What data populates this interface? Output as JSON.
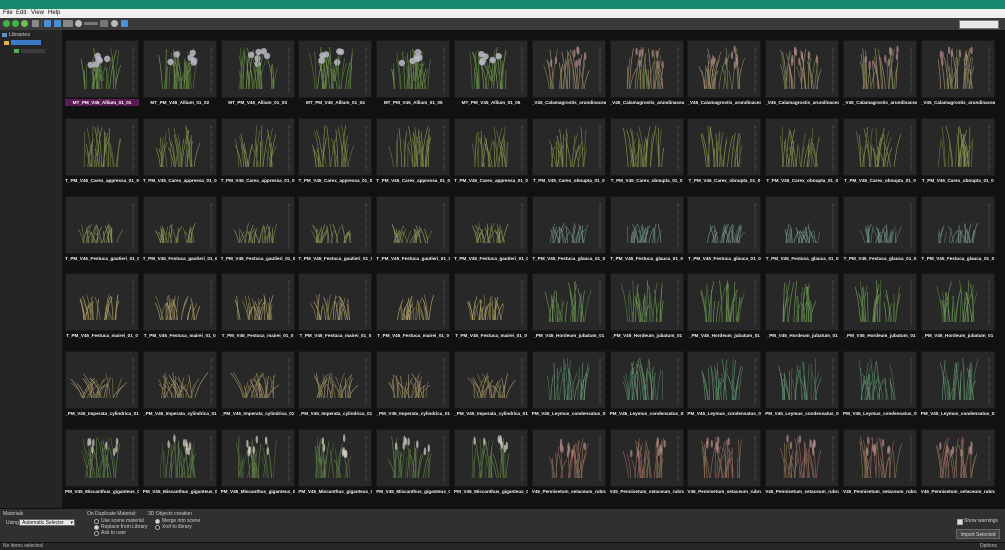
{
  "menu": {
    "file": "File",
    "edit": "Edit",
    "view": "View",
    "help": "Help"
  },
  "tree": {
    "root": "Libraries"
  },
  "materials": {
    "section": "Materials",
    "using_label": "Using:",
    "using_value": "Automatic Selector",
    "on_duplicate_title": "On Duplicate Material:",
    "options": [
      "Use scene material",
      "Replace from Library",
      "Ask to user"
    ],
    "selected_option": 1
  },
  "objects": {
    "title": "3D Objects creation",
    "options": [
      "Merge into scene",
      "Xref to library"
    ],
    "selected_option": 0
  },
  "show_warnings": "Show warnings",
  "import_button": "Import Selected",
  "status": {
    "left": "No items selected",
    "right": "Options"
  },
  "colors": {
    "titlebar": "#17876e",
    "selection": "#5a1a52"
  },
  "tiles": [
    {
      "label": "MT_PM_V45_Allium_01_01",
      "kind": "allium",
      "selected": true
    },
    {
      "label": "MT_PM_V45_Allium_01_02",
      "kind": "allium"
    },
    {
      "label": "MT_PM_V45_Allium_01_03",
      "kind": "allium"
    },
    {
      "label": "MT_PM_V45_Allium_01_04",
      "kind": "allium"
    },
    {
      "label": "MT_PM_V45_Allium_01_05",
      "kind": "allium"
    },
    {
      "label": "MT_PM_V45_Allium_01_06",
      "kind": "allium"
    },
    {
      "label": "_V45_Calamagrostis_arundinacea",
      "kind": "plume"
    },
    {
      "label": "_V45_Calamagrostis_arundinacea",
      "kind": "plume"
    },
    {
      "label": "_V45_Calamagrostis_arundinacea",
      "kind": "plume"
    },
    {
      "label": "_V45_Calamagrostis_arundinacea",
      "kind": "plume"
    },
    {
      "label": "_V45_Calamagrostis_arundinacea",
      "kind": "plume"
    },
    {
      "label": "_V45_Calamagrostis_arundinacea",
      "kind": "plume"
    },
    {
      "label": "T_PM_V45_Carex_appressa_01_0",
      "kind": "grass"
    },
    {
      "label": "T_PM_V45_Carex_appressa_01_0",
      "kind": "grass"
    },
    {
      "label": "T_PM_V45_Carex_appressa_01_0",
      "kind": "grass"
    },
    {
      "label": "T_PM_V45_Carex_appressa_01_0",
      "kind": "grass"
    },
    {
      "label": "T_PM_V45_Carex_appressa_01_0",
      "kind": "grass"
    },
    {
      "label": "T_PM_V45_Carex_appressa_01_0",
      "kind": "grass"
    },
    {
      "label": "T_PM_V45_Carex_obnupta_01_0",
      "kind": "grass"
    },
    {
      "label": "T_PM_V45_Carex_obnupta_01_0",
      "kind": "grass"
    },
    {
      "label": "T_PM_V45_Carex_obnupta_01_0",
      "kind": "grass"
    },
    {
      "label": "T_PM_V45_Carex_obnupta_01_0",
      "kind": "grass"
    },
    {
      "label": "T_PM_V45_Carex_obnupta_01_0",
      "kind": "grass"
    },
    {
      "label": "T_PM_V45_Carex_obnupta_01_0",
      "kind": "grass"
    },
    {
      "label": "T_PM_V45_Festuca_gautieri_01_0",
      "kind": "mound"
    },
    {
      "label": "T_PM_V45_Festuca_gautieri_01_0",
      "kind": "mound"
    },
    {
      "label": "T_PM_V45_Festuca_gautieri_01_0",
      "kind": "mound"
    },
    {
      "label": "T_PM_V45_Festuca_gautieri_01_0",
      "kind": "mound"
    },
    {
      "label": "T_PM_V45_Festuca_gautieri_01_0",
      "kind": "mound"
    },
    {
      "label": "T_PM_V45_Festuca_gautieri_01_0",
      "kind": "mound"
    },
    {
      "label": "T_PM_V45_Festuca_glauca_01_0",
      "kind": "blue"
    },
    {
      "label": "T_PM_V45_Festuca_glauca_01_0",
      "kind": "blue"
    },
    {
      "label": "T_PM_V45_Festuca_glauca_01_0",
      "kind": "blue"
    },
    {
      "label": "T_PM_V45_Festuca_glauca_01_0",
      "kind": "blue"
    },
    {
      "label": "T_PM_V45_Festuca_glauca_01_0",
      "kind": "blue"
    },
    {
      "label": "T_PM_V45_Festuca_glauca_01_0",
      "kind": "blue"
    },
    {
      "label": "T_PM_V45_Festuca_mairei_01_0",
      "kind": "straw"
    },
    {
      "label": "T_PM_V45_Festuca_mairei_01_0",
      "kind": "straw"
    },
    {
      "label": "T_PM_V45_Festuca_mairei_01_0",
      "kind": "straw"
    },
    {
      "label": "T_PM_V45_Festuca_mairei_01_0",
      "kind": "straw"
    },
    {
      "label": "T_PM_V45_Festuca_mairei_01_0",
      "kind": "straw"
    },
    {
      "label": "T_PM_V45_Festuca_mairei_01_0",
      "kind": "straw"
    },
    {
      "label": "_PM_V45_Hordeum_jubatum_01",
      "kind": "hordeum"
    },
    {
      "label": "_PM_V45_Hordeum_jubatum_01",
      "kind": "hordeum"
    },
    {
      "label": "_PM_V45_Hordeum_jubatum_01",
      "kind": "hordeum"
    },
    {
      "label": "_PM_V45_Hordeum_jubatum_01",
      "kind": "hordeum"
    },
    {
      "label": "_PM_V45_Hordeum_jubatum_01",
      "kind": "hordeum"
    },
    {
      "label": "_PM_V45_Hordeum_jubatum_01",
      "kind": "hordeum"
    },
    {
      "label": "_PM_V45_Imperata_cylindrica_01",
      "kind": "imperata"
    },
    {
      "label": "_PM_V45_Imperata_cylindrica_01",
      "kind": "imperata"
    },
    {
      "label": "_PM_V45_Imperata_cylindrica_01",
      "kind": "imperata"
    },
    {
      "label": "_PM_V45_Imperata_cylindrica_01",
      "kind": "imperata"
    },
    {
      "label": "_PM_V45_Imperata_cylindrica_01",
      "kind": "imperata"
    },
    {
      "label": "_PM_V45_Imperata_cylindrica_01",
      "kind": "imperata"
    },
    {
      "label": "PM_V45_Leymus_condensatus_01",
      "kind": "leymus"
    },
    {
      "label": "PM_V45_Leymus_condensatus_01",
      "kind": "leymus"
    },
    {
      "label": "PM_V45_Leymus_condensatus_01",
      "kind": "leymus"
    },
    {
      "label": "PM_V45_Leymus_condensatus_01",
      "kind": "leymus"
    },
    {
      "label": "PM_V45_Leymus_condensatus_01",
      "kind": "leymus"
    },
    {
      "label": "PM_V45_Leymus_condensatus_01",
      "kind": "leymus"
    },
    {
      "label": "PM_V45_Miscanthus_giganteus_0",
      "kind": "miscanthus"
    },
    {
      "label": "PM_V45_Miscanthus_giganteus_0",
      "kind": "miscanthus"
    },
    {
      "label": "PM_V45_Miscanthus_giganteus_0",
      "kind": "miscanthus"
    },
    {
      "label": "PM_V45_Miscanthus_giganteus_0",
      "kind": "miscanthus"
    },
    {
      "label": "PM_V45_Miscanthus_giganteus_0",
      "kind": "miscanthus"
    },
    {
      "label": "PM_V45_Miscanthus_giganteus_0",
      "kind": "miscanthus"
    },
    {
      "label": "V45_Pennisetum_setaceum_rubru",
      "kind": "pennisetum"
    },
    {
      "label": "V45_Pennisetum_setaceum_rubru",
      "kind": "pennisetum"
    },
    {
      "label": "V45_Pennisetum_setaceum_rubru",
      "kind": "pennisetum"
    },
    {
      "label": "V45_Pennisetum_setaceum_rubru",
      "kind": "pennisetum"
    },
    {
      "label": "V45_Pennisetum_setaceum_rubru",
      "kind": "pennisetum"
    },
    {
      "label": "V45_Pennisetum_setaceum_rubru",
      "kind": "pennisetum"
    }
  ]
}
